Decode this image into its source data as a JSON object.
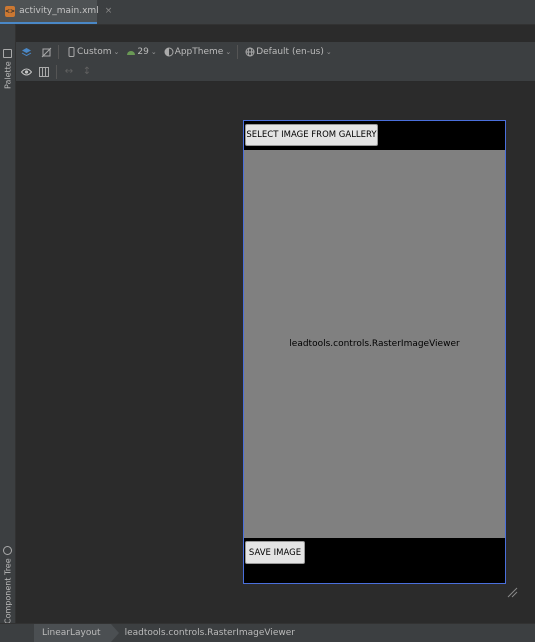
{
  "tab": {
    "filename": "activity_main.xml",
    "close": "×",
    "icon": "xml-file-icon"
  },
  "side": {
    "palette": "Palette",
    "component_tree": "Component Tree"
  },
  "toolbar": {
    "device": "Custom",
    "api": "29",
    "theme": "AppTheme",
    "locale": "Default (en-us)"
  },
  "device_preview": {
    "select_button": "SELECT IMAGE FROM GALLERY",
    "viewer_label": "leadtools.controls.RasterImageViewer",
    "save_button": "SAVE IMAGE"
  },
  "breadcrumb": {
    "items": [
      "LinearLayout",
      "leadtools.controls.RasterImageViewer"
    ]
  },
  "colors": {
    "accent": "#4a88c7",
    "device_border": "#4a6fdc",
    "viewer_bg": "#808080",
    "android_green": "#6a9955"
  }
}
